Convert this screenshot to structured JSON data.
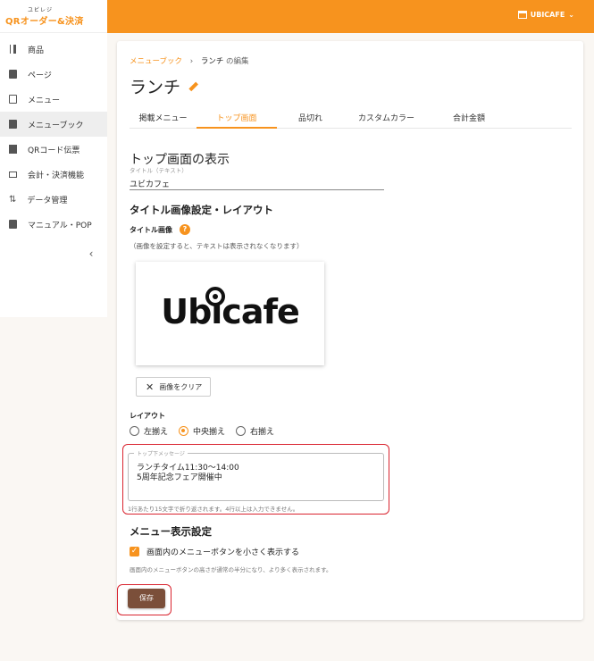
{
  "app": {
    "logo_small": "ユビレジ",
    "logo_main": "QRオーダー&決済",
    "store_name": "UBICAFE"
  },
  "sidebar": {
    "items": [
      {
        "label": "商品",
        "icon": "fork-knife-icon"
      },
      {
        "label": "ページ",
        "icon": "page-icon"
      },
      {
        "label": "メニュー",
        "icon": "list-icon"
      },
      {
        "label": "メニューブック",
        "icon": "book-icon"
      },
      {
        "label": "QRコード伝票",
        "icon": "receipt-icon"
      },
      {
        "label": "会計・決済機能",
        "icon": "payment-icon"
      },
      {
        "label": "データ管理",
        "icon": "data-transfer-icon"
      },
      {
        "label": "マニュアル・POP",
        "icon": "manual-icon"
      }
    ],
    "active_index": 3,
    "collapse_glyph": "‹"
  },
  "breadcrumb": {
    "link": "メニューブック",
    "separator": "›",
    "current": "ランチ",
    "suffix": "の編集"
  },
  "title": "ランチ",
  "tabs": [
    "掲載メニュー",
    "トップ画面",
    "品切れ",
    "カスタムカラー",
    "合計金額"
  ],
  "active_tab": 1,
  "top_display": {
    "section_title": "トップ画面の表示",
    "title_field_label": "タイトル（テキスト）",
    "title_field_value": "ユビカフェ"
  },
  "image_layout": {
    "heading": "タイトル画像設定・レイアウト",
    "image_label": "タイトル画像",
    "help_glyph": "?",
    "image_note": "（画像を設定すると、テキストは表示されなくなります）",
    "image_logo_text": "Ubicafe",
    "clear_button": "画像をクリア",
    "layout_label": "レイアウト",
    "layout_options": [
      "左揃え",
      "中央揃え",
      "右揃え"
    ],
    "layout_selected": "中央揃え",
    "message_label": "トップ下メッセージ",
    "message_value": "ランチタイム11:30〜14:00\n5周年記念フェア開催中",
    "message_helper": "1行あたり15文字で折り返されます。4行以上は入力できません。"
  },
  "menu_display": {
    "heading": "メニュー表示設定",
    "checkbox_label": "画面内のメニューボタンを小さく表示する",
    "checkbox_checked": true,
    "checkbox_note": "画面内のメニューボタンの高さが通常の半分になり、より多く表示されます。"
  },
  "save_button": "保存",
  "colors": {
    "accent": "#f7931e",
    "save": "#7b4f3a",
    "highlight": "#d9232e"
  }
}
